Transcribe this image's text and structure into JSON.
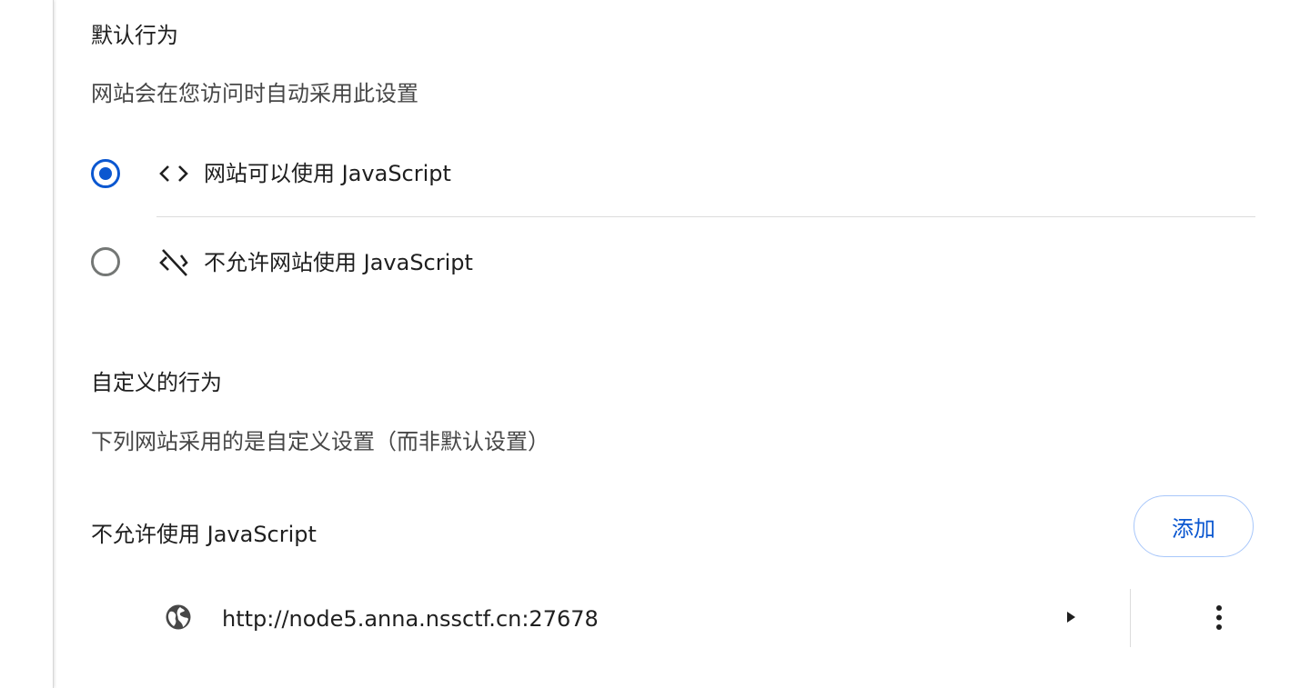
{
  "default_behavior": {
    "heading": "默认行为",
    "description": "网站会在您访问时自动采用此设置",
    "options": [
      {
        "label": "网站可以使用 JavaScript",
        "checked": true,
        "icon": "code-icon"
      },
      {
        "label": "不允许网站使用 JavaScript",
        "checked": false,
        "icon": "code-off-icon"
      }
    ]
  },
  "custom_behavior": {
    "heading": "自定义的行为",
    "description": "下列网站采用的是自定义设置（而非默认设置）"
  },
  "blocked_list": {
    "heading": "不允许使用 JavaScript",
    "add_button_label": "添加",
    "sites": [
      {
        "url": "http://node5.anna.nssctf.cn:27678",
        "icon": "globe-icon"
      }
    ]
  },
  "colors": {
    "accent": "#0b57d0",
    "button_border": "#a8c7fa",
    "text_primary": "#1f1f1f",
    "text_secondary": "#474747",
    "radio_unchecked": "#747775",
    "divider": "#dcdcdc"
  }
}
